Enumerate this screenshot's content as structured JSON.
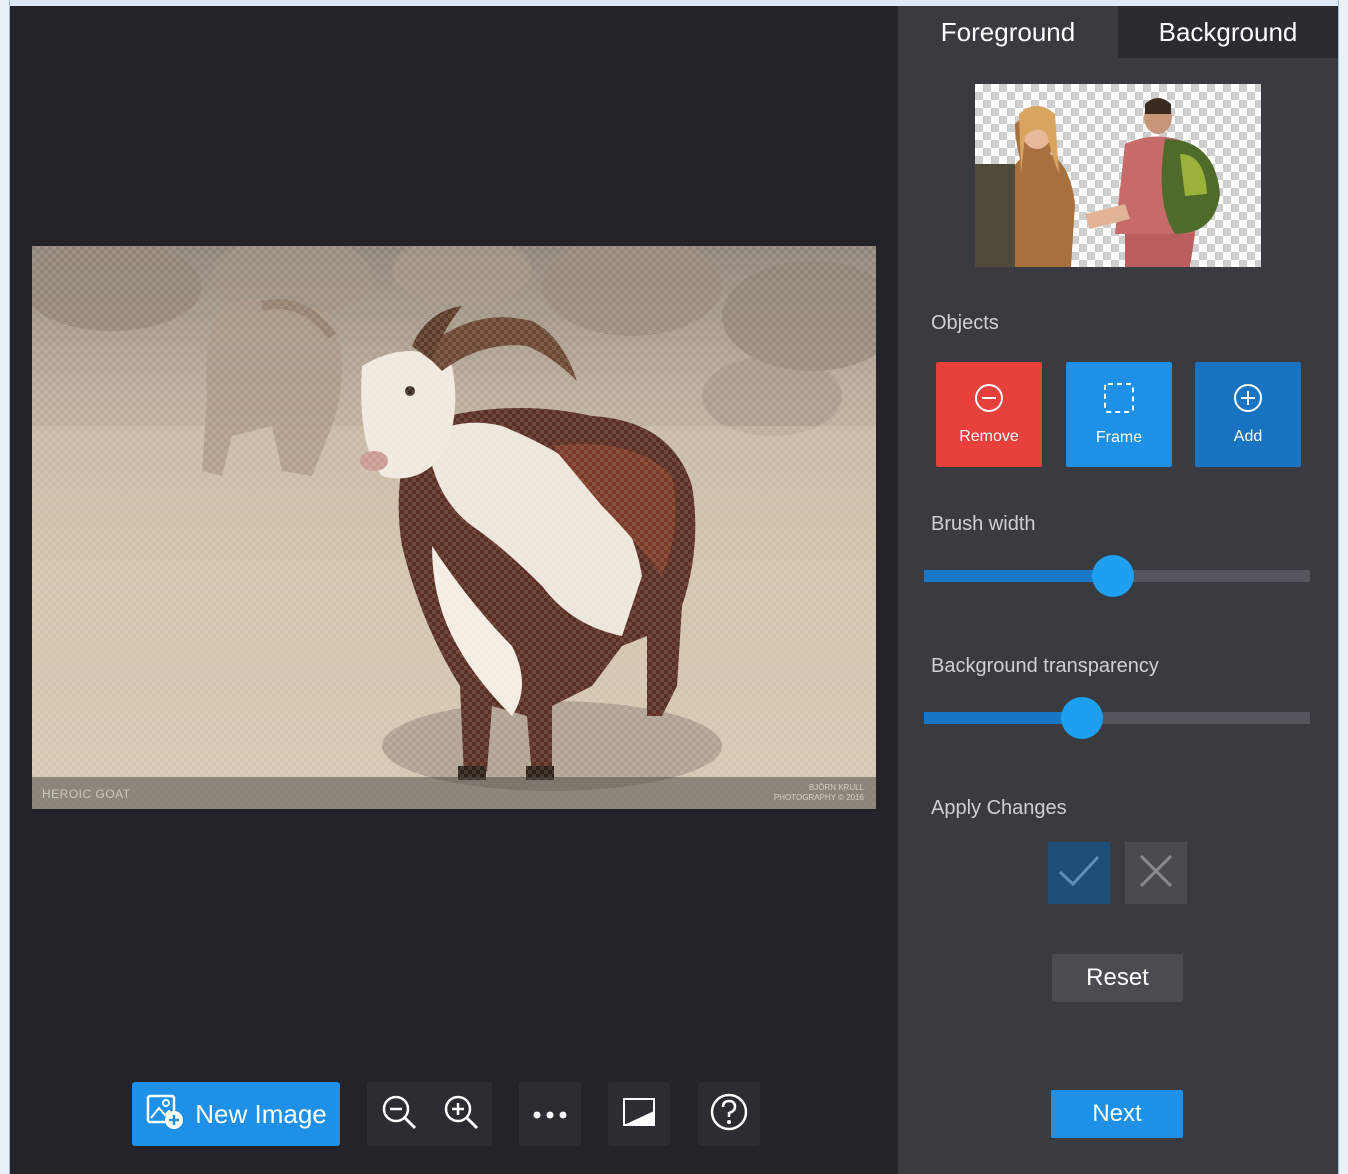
{
  "tabs": {
    "foreground": "Foreground",
    "background": "Background"
  },
  "photo": {
    "watermark_left": "HEROIC GOAT",
    "watermark_right_1": "BJÖRN KRULL",
    "watermark_right_2": "PHOTOGRAPHY © 2016"
  },
  "toolbar": {
    "new_image": "New Image",
    "icons": [
      "new-image-icon",
      "zoom-out-icon",
      "zoom-in-icon",
      "more-icon",
      "compare-icon",
      "help-icon"
    ]
  },
  "panel": {
    "objects_label": "Objects",
    "remove": "Remove",
    "frame": "Frame",
    "add": "Add",
    "brush_width_label": "Brush width",
    "brush_width_value": 0.49,
    "bg_transparency_label": "Background transparency",
    "bg_transparency_value": 0.41,
    "apply_label": "Apply Changes",
    "reset": "Reset",
    "next": "Next"
  },
  "colors": {
    "accent": "#1e90e8",
    "remove": "#e8403a",
    "add": "#1874c0",
    "panel": "#3a3a41",
    "canvas": "#232329"
  }
}
